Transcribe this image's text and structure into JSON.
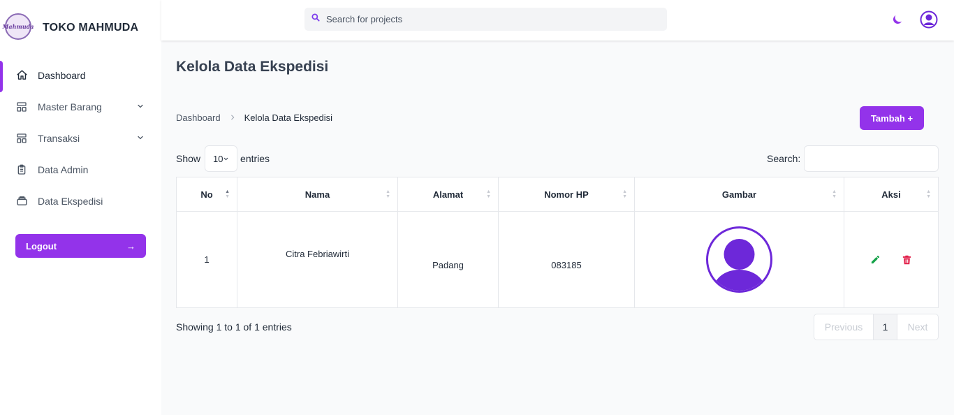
{
  "brand": {
    "name": "TOKO MAHMUDA",
    "logo_text": "Mahmuda"
  },
  "header": {
    "search_placeholder": "Search for projects"
  },
  "sidebar": {
    "items": [
      {
        "label": "Dashboard",
        "icon": "home-icon"
      },
      {
        "label": "Master Barang",
        "icon": "layout-icon"
      },
      {
        "label": "Transaksi",
        "icon": "layout-icon"
      },
      {
        "label": "Data Admin",
        "icon": "clipboard-icon"
      },
      {
        "label": "Data Ekspedisi",
        "icon": "inbox-icon"
      }
    ],
    "logout_label": "Logout",
    "logout_arrow": "→"
  },
  "page": {
    "title": "Kelola Data Ekspedisi",
    "breadcrumb": {
      "home": "Dashboard",
      "separator": ">",
      "current": "Kelola Data Ekspedisi"
    },
    "add_button": "Tambah +"
  },
  "table_controls": {
    "show_label": "Show",
    "entries_value": "10",
    "entries_label": "entries",
    "search_label": "Search:"
  },
  "table": {
    "columns": [
      "No",
      "Nama",
      "Alamat",
      "Nomor HP",
      "Gambar",
      "Aksi"
    ],
    "rows": [
      {
        "no": "1",
        "nama": "Citra Febriawirti",
        "alamat": "Padang",
        "nomor_hp": "083185"
      }
    ]
  },
  "pagination": {
    "info": "Showing 1 to 1 of 1 entries",
    "previous": "Previous",
    "current": "1",
    "next": "Next"
  },
  "colors": {
    "accent": "#9333ea",
    "edit": "#16a34a",
    "delete": "#e11d48",
    "avatar": "#6d28d9"
  }
}
